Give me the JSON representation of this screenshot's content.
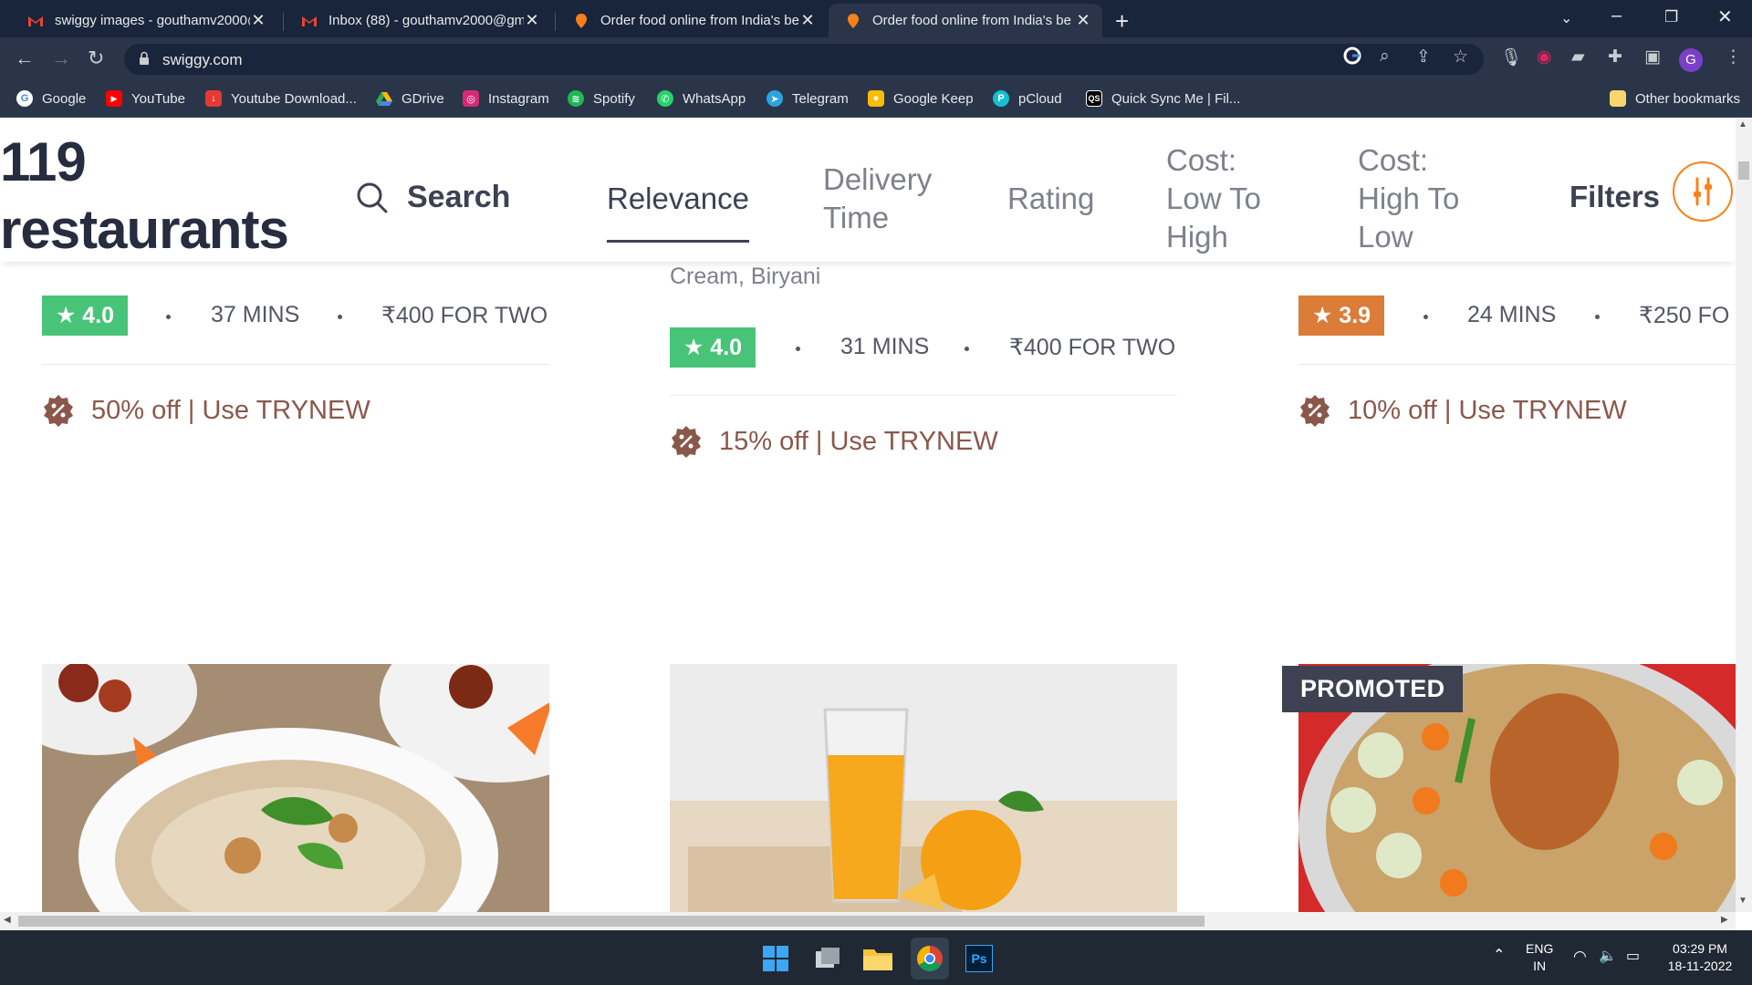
{
  "browser": {
    "tabs": [
      {
        "title": "swiggy images - gouthamv2000@",
        "favicon": "gmail-icon",
        "active": false
      },
      {
        "title": "Inbox (88) - gouthamv2000@gm",
        "favicon": "gmail-icon",
        "active": false
      },
      {
        "title": "Order food online from India's be",
        "favicon": "swiggy-icon",
        "active": false
      },
      {
        "title": "Order food online from India's be",
        "favicon": "swiggy-icon",
        "active": true
      }
    ],
    "url": "swiggy.com",
    "profile_initial": "G",
    "bookmarks": [
      {
        "label": "Google",
        "icon": "google-icon",
        "color": "#ffffff"
      },
      {
        "label": "YouTube",
        "icon": "youtube-icon",
        "color": "#ff0000"
      },
      {
        "label": "Youtube Download...",
        "icon": "download-icon",
        "color": "#e53935"
      },
      {
        "label": "GDrive",
        "icon": "gdrive-icon",
        "color": "#34a853"
      },
      {
        "label": "Instagram",
        "icon": "instagram-icon",
        "color": "#d62976"
      },
      {
        "label": "Spotify",
        "icon": "spotify-icon",
        "color": "#1db954"
      },
      {
        "label": "WhatsApp",
        "icon": "whatsapp-icon",
        "color": "#25d366"
      },
      {
        "label": "Telegram",
        "icon": "telegram-icon",
        "color": "#2aa3e0"
      },
      {
        "label": "Google Keep",
        "icon": "keep-icon",
        "color": "#fbbc04"
      },
      {
        "label": "pCloud",
        "icon": "pcloud-icon",
        "color": "#17bed0"
      },
      {
        "label": "Quick Sync Me | Fil...",
        "icon": "qs-icon",
        "color": "#000000"
      }
    ],
    "other_bookmarks": "Other bookmarks"
  },
  "page": {
    "count_line1": "119",
    "count_line2": "restaurants",
    "search_label": "Search",
    "sort_options": {
      "relevance": "Relevance",
      "delivery_1": "Delivery",
      "delivery_2": "Time",
      "rating": "Rating",
      "low_1": "Cost:",
      "low_2": "Low To",
      "low_3": "High",
      "high_1": "Cost:",
      "high_2": "High To",
      "high_3": "Low"
    },
    "filters_label": "Filters",
    "accent": "#fc8019"
  },
  "cards": [
    {
      "rating": "★ 4.0",
      "rating_color": "#48c479",
      "time": "37 MINS",
      "cost": "₹400 FOR TWO",
      "offer": "50% off | Use TRYNEW"
    },
    {
      "cuisine_tail": "Cream, Biryani",
      "rating": "★ 4.0",
      "rating_color": "#48c479",
      "time": "31 MINS",
      "cost": "₹400 FOR TWO",
      "offer": "15% off | Use TRYNEW"
    },
    {
      "rating": "★ 3.9",
      "rating_color": "#db7c38",
      "time": "24 MINS",
      "cost": "₹250 FO",
      "offer": "10% off | Use TRYNEW",
      "promoted": "PROMOTED"
    }
  ],
  "taskbar": {
    "lang_1": "ENG",
    "lang_2": "IN",
    "time": "03:29 PM",
    "date": "18-11-2022"
  }
}
